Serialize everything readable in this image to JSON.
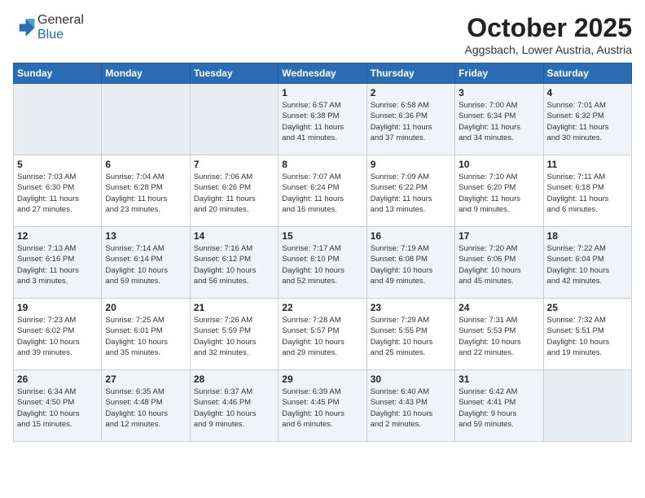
{
  "header": {
    "logo_general": "General",
    "logo_blue": "Blue",
    "month": "October 2025",
    "location": "Aggsbach, Lower Austria, Austria"
  },
  "days_of_week": [
    "Sunday",
    "Monday",
    "Tuesday",
    "Wednesday",
    "Thursday",
    "Friday",
    "Saturday"
  ],
  "weeks": [
    [
      {
        "day": "",
        "content": ""
      },
      {
        "day": "",
        "content": ""
      },
      {
        "day": "",
        "content": ""
      },
      {
        "day": "1",
        "content": "Sunrise: 6:57 AM\nSunset: 6:38 PM\nDaylight: 11 hours\nand 41 minutes."
      },
      {
        "day": "2",
        "content": "Sunrise: 6:58 AM\nSunset: 6:36 PM\nDaylight: 11 hours\nand 37 minutes."
      },
      {
        "day": "3",
        "content": "Sunrise: 7:00 AM\nSunset: 6:34 PM\nDaylight: 11 hours\nand 34 minutes."
      },
      {
        "day": "4",
        "content": "Sunrise: 7:01 AM\nSunset: 6:32 PM\nDaylight: 11 hours\nand 30 minutes."
      }
    ],
    [
      {
        "day": "5",
        "content": "Sunrise: 7:03 AM\nSunset: 6:30 PM\nDaylight: 11 hours\nand 27 minutes."
      },
      {
        "day": "6",
        "content": "Sunrise: 7:04 AM\nSunset: 6:28 PM\nDaylight: 11 hours\nand 23 minutes."
      },
      {
        "day": "7",
        "content": "Sunrise: 7:06 AM\nSunset: 6:26 PM\nDaylight: 11 hours\nand 20 minutes."
      },
      {
        "day": "8",
        "content": "Sunrise: 7:07 AM\nSunset: 6:24 PM\nDaylight: 11 hours\nand 16 minutes."
      },
      {
        "day": "9",
        "content": "Sunrise: 7:09 AM\nSunset: 6:22 PM\nDaylight: 11 hours\nand 13 minutes."
      },
      {
        "day": "10",
        "content": "Sunrise: 7:10 AM\nSunset: 6:20 PM\nDaylight: 11 hours\nand 9 minutes."
      },
      {
        "day": "11",
        "content": "Sunrise: 7:11 AM\nSunset: 6:18 PM\nDaylight: 11 hours\nand 6 minutes."
      }
    ],
    [
      {
        "day": "12",
        "content": "Sunrise: 7:13 AM\nSunset: 6:16 PM\nDaylight: 11 hours\nand 3 minutes."
      },
      {
        "day": "13",
        "content": "Sunrise: 7:14 AM\nSunset: 6:14 PM\nDaylight: 10 hours\nand 59 minutes."
      },
      {
        "day": "14",
        "content": "Sunrise: 7:16 AM\nSunset: 6:12 PM\nDaylight: 10 hours\nand 56 minutes."
      },
      {
        "day": "15",
        "content": "Sunrise: 7:17 AM\nSunset: 6:10 PM\nDaylight: 10 hours\nand 52 minutes."
      },
      {
        "day": "16",
        "content": "Sunrise: 7:19 AM\nSunset: 6:08 PM\nDaylight: 10 hours\nand 49 minutes."
      },
      {
        "day": "17",
        "content": "Sunrise: 7:20 AM\nSunset: 6:06 PM\nDaylight: 10 hours\nand 45 minutes."
      },
      {
        "day": "18",
        "content": "Sunrise: 7:22 AM\nSunset: 6:04 PM\nDaylight: 10 hours\nand 42 minutes."
      }
    ],
    [
      {
        "day": "19",
        "content": "Sunrise: 7:23 AM\nSunset: 6:02 PM\nDaylight: 10 hours\nand 39 minutes."
      },
      {
        "day": "20",
        "content": "Sunrise: 7:25 AM\nSunset: 6:01 PM\nDaylight: 10 hours\nand 35 minutes."
      },
      {
        "day": "21",
        "content": "Sunrise: 7:26 AM\nSunset: 5:59 PM\nDaylight: 10 hours\nand 32 minutes."
      },
      {
        "day": "22",
        "content": "Sunrise: 7:28 AM\nSunset: 5:57 PM\nDaylight: 10 hours\nand 29 minutes."
      },
      {
        "day": "23",
        "content": "Sunrise: 7:29 AM\nSunset: 5:55 PM\nDaylight: 10 hours\nand 25 minutes."
      },
      {
        "day": "24",
        "content": "Sunrise: 7:31 AM\nSunset: 5:53 PM\nDaylight: 10 hours\nand 22 minutes."
      },
      {
        "day": "25",
        "content": "Sunrise: 7:32 AM\nSunset: 5:51 PM\nDaylight: 10 hours\nand 19 minutes."
      }
    ],
    [
      {
        "day": "26",
        "content": "Sunrise: 6:34 AM\nSunset: 4:50 PM\nDaylight: 10 hours\nand 15 minutes."
      },
      {
        "day": "27",
        "content": "Sunrise: 6:35 AM\nSunset: 4:48 PM\nDaylight: 10 hours\nand 12 minutes."
      },
      {
        "day": "28",
        "content": "Sunrise: 6:37 AM\nSunset: 4:46 PM\nDaylight: 10 hours\nand 9 minutes."
      },
      {
        "day": "29",
        "content": "Sunrise: 6:39 AM\nSunset: 4:45 PM\nDaylight: 10 hours\nand 6 minutes."
      },
      {
        "day": "30",
        "content": "Sunrise: 6:40 AM\nSunset: 4:43 PM\nDaylight: 10 hours\nand 2 minutes."
      },
      {
        "day": "31",
        "content": "Sunrise: 6:42 AM\nSunset: 4:41 PM\nDaylight: 9 hours\nand 59 minutes."
      },
      {
        "day": "",
        "content": ""
      }
    ]
  ]
}
